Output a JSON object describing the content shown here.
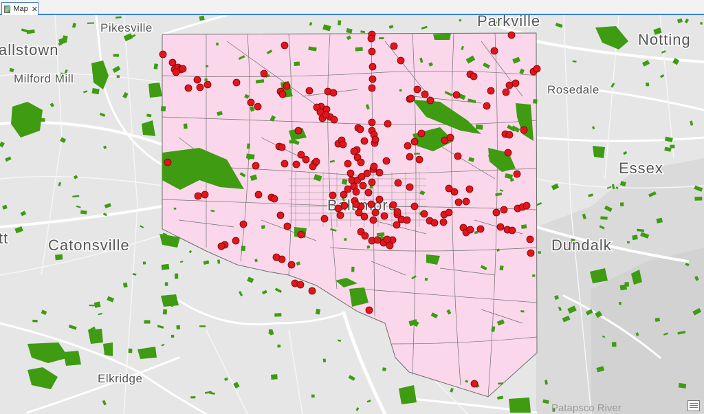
{
  "tab": {
    "title": "Map",
    "close_glyph": "✕",
    "icon": "map-icon"
  },
  "colors": {
    "basemap": "#e6e6e6",
    "road": "#ffffff",
    "park": "#3e9b12",
    "city_fill": "#fad7ea",
    "city_stroke": "#6d6d6d",
    "point_fill": "#e0161c",
    "point_stroke": "#7a0000"
  },
  "labels": {
    "pikesville": "Pikesville",
    "parkville": "Parkville",
    "ownings_mills": "allstown",
    "notting": "Notting",
    "milford_mill": "Milford Mill",
    "rosedale": "Rosedale",
    "essex": "Essex",
    "baltimore": "Baltimore",
    "catonsville": "Catonsville",
    "tt": "tt",
    "dundalk": "Dundalk",
    "elkridge": "Elkridge",
    "patapsco": "Patapsco River"
  },
  "point_layer": {
    "symbol": "circle",
    "count_shown": 230
  }
}
